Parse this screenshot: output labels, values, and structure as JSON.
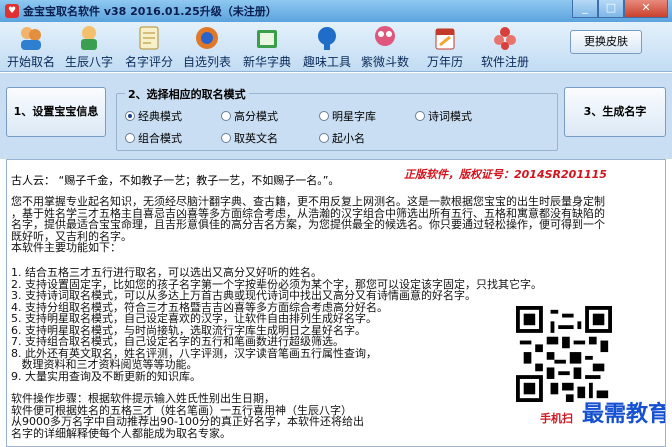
{
  "window": {
    "title": "金宝宝取名软件 v38  2016.01.25升级（未注册）",
    "controls": [
      "_",
      "□",
      "✕"
    ]
  },
  "toolbar": {
    "items": [
      {
        "label": "开始取名",
        "icon": "start-naming-icon"
      },
      {
        "label": "生辰八字",
        "icon": "birth-bazi-icon"
      },
      {
        "label": "名字评分",
        "icon": "name-score-icon"
      },
      {
        "label": "自选列表",
        "icon": "custom-list-icon"
      },
      {
        "label": "新华字典",
        "icon": "dictionary-icon"
      },
      {
        "label": "趣味工具",
        "icon": "fun-tools-icon"
      },
      {
        "label": "紫微斗数",
        "icon": "ziwei-icon"
      },
      {
        "label": "万年历",
        "icon": "calendar-icon"
      },
      {
        "label": "软件注册",
        "icon": "register-icon"
      }
    ],
    "skin_button": "更换皮肤"
  },
  "setup": {
    "step1": "1、设置宝宝信息",
    "step3": "3、生成名字",
    "mode_title": "2、选择相应的取名模式",
    "modes": [
      {
        "label": "经典模式",
        "checked": true
      },
      {
        "label": "高分模式",
        "checked": false
      },
      {
        "label": "明星字库",
        "checked": false
      },
      {
        "label": "诗词模式",
        "checked": false
      },
      {
        "label": "组合模式",
        "checked": false
      },
      {
        "label": "取英文名",
        "checked": false
      },
      {
        "label": "起小名",
        "checked": false
      }
    ]
  },
  "content": {
    "quote": "古人云：  “赐子千金，不如教子一艺；教子一艺，不如赐子一名。”。",
    "registration": "正版软件，版权证号：2014SR201115",
    "intro": "您不用掌握专业起名知识，无须经尽脑汁翻字典、查古籍，更不用反复上网测名。这是一款根据您宝宝的出生时辰量身定制\n，基于姓名学三才五格主自喜忌吉凶喜等多方面综合考虑，从浩瀚的汉字组合中筛选出所有五行、五格和寓意都没有缺陷的\n名字，提供最适合宝宝命理，且吉形意俱佳的高分吉名方案，为您提供最全的候选名。你只要通过轻松操作，便可得到一个\n既好听，又吉利的名字。\n本软件主要功能如下：",
    "features": "1. 结合五格三才五行进行取名，可以选出又高分又好听的姓名。\n2. 支持设置固定字，比如您的孩子名字第一个字按辈份必须为某个字，那您可以设定该字固定，只找其它字。\n3. 支持诗词取名模式，可以从多达上万首古典或现代诗词中找出又高分又有诗情画意的好名字。\n4. 支持分组取名模式，符合三才五格暨吉吉凶喜等多方面综合考虑高分好名。\n5. 支持明星取名模式，自己设定喜欢的汉字，让软件自由排列生成好名字。\n6. 支持明星取名模式，与时尚接轨，选取流行字库生成明日之星好名字。\n7. 支持组合取名模式，自己设定名字的五行和笔画数进行超级筛选。\n8. 此外还有英文取名，姓名评测，八字评测，汉字读音笔画五行属性查询，\n   数理资料和三才资料阅览等等功能。\n9. 大量实用查询及不断更新的知识库。",
    "steps": "软件操作步骤：根据软件提示输入姓氏性别出生日期，\n软件便可根据姓名的五格三才（姓名笔画）一五行喜用神（生辰八字）\n从9000多万名字中自动推荐出90-100分的真正好名字，本软件还将给出\n名字的详细解释使每个人都能成为取名专家。",
    "phone_hint": "手机扫",
    "watermark": "最需教育"
  }
}
